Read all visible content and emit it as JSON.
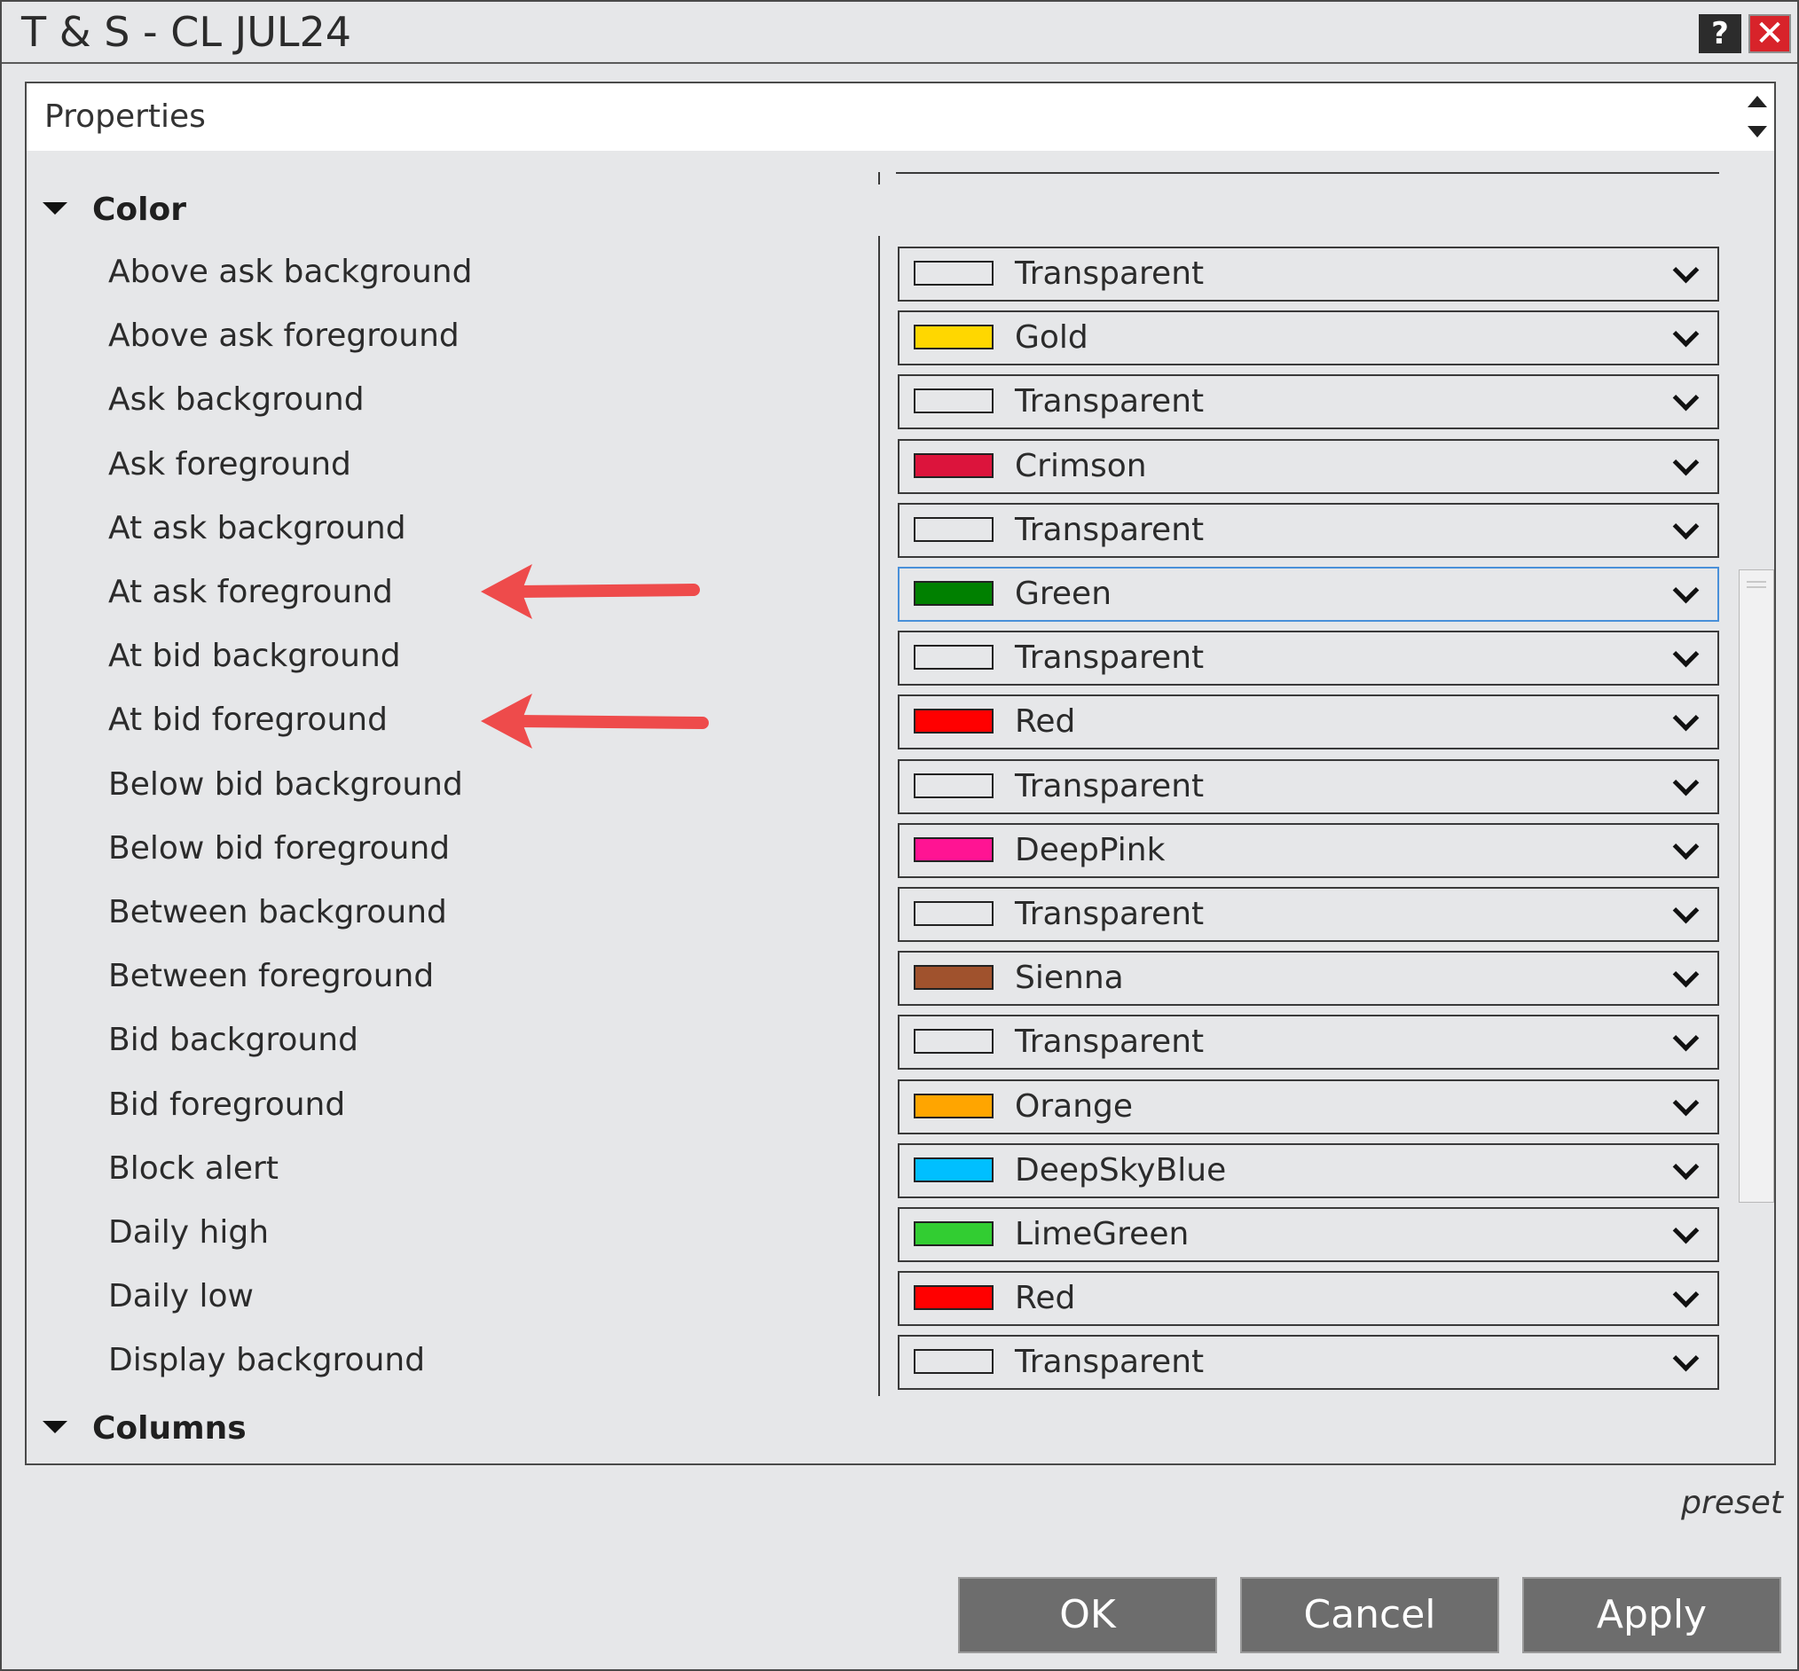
{
  "window": {
    "title": "T & S - CL JUL24",
    "help_label": "?",
    "close_label": "✕"
  },
  "properties": {
    "header": "Properties",
    "categories": [
      {
        "label": "Color",
        "expanded": true
      },
      {
        "label": "Columns",
        "expanded": true
      }
    ],
    "rows": [
      {
        "label": "Above ask background",
        "value": "Transparent",
        "color": "transparent"
      },
      {
        "label": "Above ask foreground",
        "value": "Gold",
        "color": "#FFD700"
      },
      {
        "label": "Ask background",
        "value": "Transparent",
        "color": "transparent"
      },
      {
        "label": "Ask foreground",
        "value": "Crimson",
        "color": "#DC143C"
      },
      {
        "label": "At ask background",
        "value": "Transparent",
        "color": "transparent"
      },
      {
        "label": "At ask foreground",
        "value": "Green",
        "color": "#008000"
      },
      {
        "label": "At bid background",
        "value": "Transparent",
        "color": "transparent"
      },
      {
        "label": "At bid foreground",
        "value": "Red",
        "color": "#FF0000"
      },
      {
        "label": "Below bid background",
        "value": "Transparent",
        "color": "transparent"
      },
      {
        "label": "Below bid foreground",
        "value": "DeepPink",
        "color": "#FF1493"
      },
      {
        "label": "Between background",
        "value": "Transparent",
        "color": "transparent"
      },
      {
        "label": "Between foreground",
        "value": "Sienna",
        "color": "#A0522D"
      },
      {
        "label": "Bid background",
        "value": "Transparent",
        "color": "transparent"
      },
      {
        "label": "Bid foreground",
        "value": "Orange",
        "color": "#FFA500"
      },
      {
        "label": "Block alert",
        "value": "DeepSkyBlue",
        "color": "#00BFFF"
      },
      {
        "label": "Daily high",
        "value": "LimeGreen",
        "color": "#32CD32"
      },
      {
        "label": "Daily low",
        "value": "Red",
        "color": "#FF0000"
      },
      {
        "label": "Display background",
        "value": "Transparent",
        "color": "transparent"
      }
    ]
  },
  "footer": {
    "preset_label": "preset",
    "ok_label": "OK",
    "cancel_label": "Cancel",
    "apply_label": "Apply"
  },
  "colors": {
    "annotation_arrow": "#ee4b4b",
    "selected_border": "#4a90d9",
    "button_bg": "#6d6d6d"
  }
}
